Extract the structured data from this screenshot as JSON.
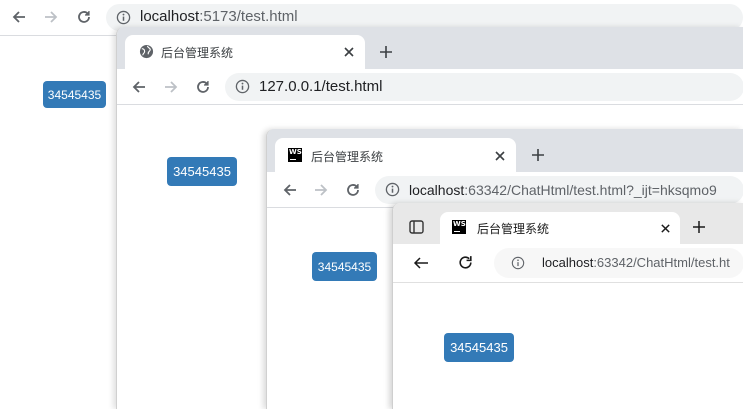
{
  "window1": {
    "url_host": "localhost",
    "url_path": ":5173/test.html",
    "badge": "34545435"
  },
  "window2": {
    "tab_title": "后台管理系统",
    "url": "127.0.0.1/test.html",
    "badge": "34545435"
  },
  "window3": {
    "tab_title": "后台管理系统",
    "url_host": "localhost",
    "url_path": ":63342/ChatHtml/test.html?_ijt=hksqmo9",
    "badge": "34545435"
  },
  "window4": {
    "tab_title": "后台管理系统",
    "url_host": "localhost",
    "url_path": ":63342/ChatHtml/test.ht",
    "badge": "34545435"
  },
  "icons": {
    "ws_logo": "WS"
  }
}
